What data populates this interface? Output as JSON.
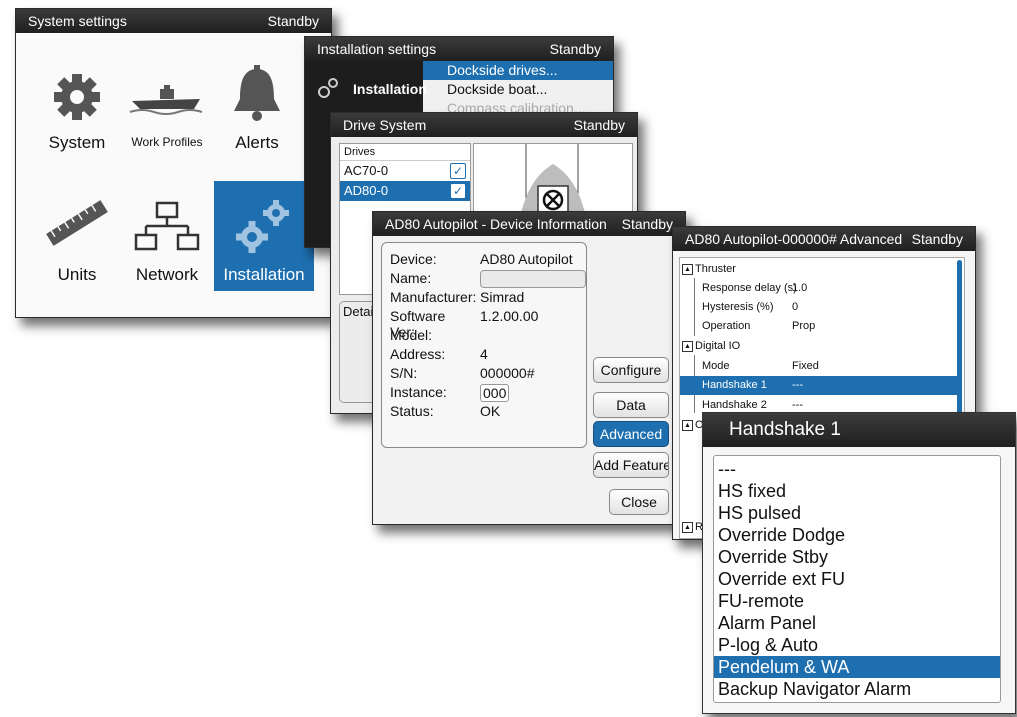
{
  "system_window": {
    "title": "System settings",
    "status": "Standby",
    "tiles": [
      {
        "label": "System",
        "icon": "gear-icon"
      },
      {
        "label": "Work Profiles",
        "icon": "boat-icon"
      },
      {
        "label": "Alerts",
        "icon": "bell-icon"
      },
      {
        "label": "Units",
        "icon": "ruler-icon"
      },
      {
        "label": "Network",
        "icon": "network-icon"
      },
      {
        "label": "Installation",
        "icon": "gears-icon"
      }
    ]
  },
  "installation_window": {
    "title": "Installation settings",
    "status": "Standby",
    "side_title": "Installation",
    "menu": [
      "Dockside drives...",
      "Dockside boat...",
      "Compass calibration..."
    ]
  },
  "drive_window": {
    "title": "Drive System",
    "status": "Standby",
    "drives_header": "Drives",
    "drives": [
      "AC70-0",
      "AD80-0"
    ],
    "details_label": "Detail"
  },
  "device_window": {
    "title": "AD80 Autopilot - Device Information",
    "status": "Standby",
    "fields": [
      {
        "key": "Device:",
        "value": "AD80 Autopilot"
      },
      {
        "key": "Name:",
        "value": ""
      },
      {
        "key": "Manufacturer:",
        "value": "Simrad"
      },
      {
        "key": "Software Ver:",
        "value": "1.2.00.00"
      },
      {
        "key": "Model:",
        "value": ""
      },
      {
        "key": "Address:",
        "value": "4"
      },
      {
        "key": "S/N:",
        "value": "000000#"
      },
      {
        "key": "Instance:",
        "value": "000"
      },
      {
        "key": "Status:",
        "value": "OK"
      }
    ],
    "buttons": [
      "Configure",
      "Data",
      "Advanced",
      "Add Feature",
      "Close"
    ]
  },
  "advanced_window": {
    "title": "AD80 Autopilot-000000# Advanced",
    "status": "Standby",
    "rows": [
      {
        "name": "Thruster",
        "value": ""
      },
      {
        "name": "Response delay (s)",
        "value": "1.0"
      },
      {
        "name": "Hysteresis (%)",
        "value": "0"
      },
      {
        "name": "Operation",
        "value": "Prop"
      },
      {
        "name": "Digital IO",
        "value": ""
      },
      {
        "name": "Mode",
        "value": "Fixed"
      },
      {
        "name": "Handshake 1",
        "value": "---"
      },
      {
        "name": "Handshake 2",
        "value": "---"
      },
      {
        "name": "Ou",
        "value": ""
      },
      {
        "name": "Re",
        "value": ""
      }
    ]
  },
  "handshake_window": {
    "title": "Handshake 1",
    "options": [
      "---",
      "HS fixed",
      "HS pulsed",
      "Override Dodge",
      "Override Stby",
      "Override ext FU",
      "FU-remote",
      "Alarm Panel",
      "P-log & Auto",
      "Pendelum & WA",
      "Backup Navigator Alarm"
    ],
    "selected": "Pendelum & WA"
  },
  "colors": {
    "accent": "#1e6fb0",
    "titlebar": "#2a2a2a"
  }
}
